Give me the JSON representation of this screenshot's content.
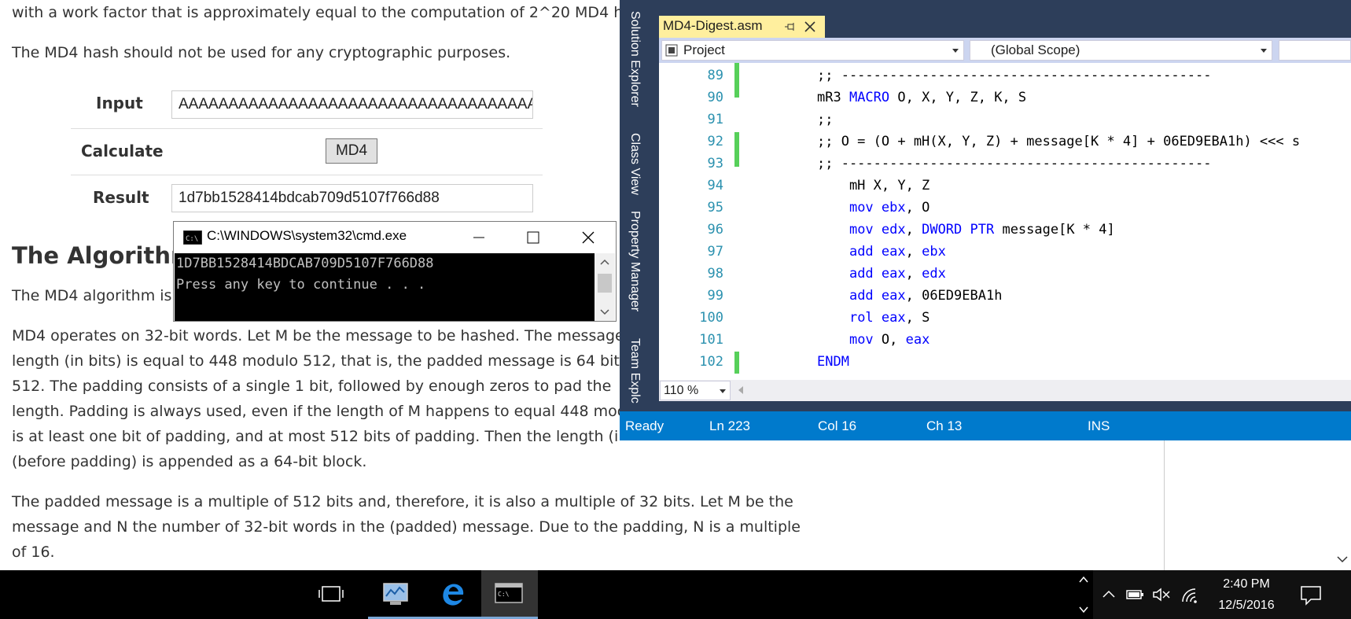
{
  "web": {
    "intro_line": "with a work factor that is approximately equal to the computation of 2^20 MD4 h",
    "warning": "The MD4 hash should not be used for any cryptographic purposes.",
    "form": {
      "input_label": "Input",
      "input_value": "AAAAAAAAAAAAAAAAAAAAAAAAAAAAAAAAAAAAAA",
      "calculate_label": "Calculate",
      "button_label": "MD4",
      "result_label": "Result",
      "result_value": "1d7bb1528414bdcab709d5107f766d88"
    },
    "heading": "The Algorithm",
    "algo_line": "The MD4 algorithm is",
    "paragraph1": [
      "MD4 operates on 32-bit words. Let M be the message to be hashed. The message",
      "length (in bits) is equal to 448 modulo 512, that is, the padded message is 64 bit",
      "512. The padding consists of a single 1 bit, followed by enough zeros to pad the",
      "length. Padding is always used, even if the length of M happens to equal 448 moc",
      "is at least one bit of padding, and at most 512 bits of padding. Then the length (i",
      "(before padding) is appended as a 64-bit block."
    ],
    "paragraph2": [
      "The padded message is a multiple of 512 bits and, therefore, it is also a multiple of 32 bits. Let M be the",
      "message and N the number of 32-bit words in the (padded) message. Due to the padding, N is a multiple",
      "of 16."
    ]
  },
  "cmd": {
    "title": "C:\\WINDOWS\\system32\\cmd.exe",
    "icon_label": "C:\\",
    "lines": [
      "1D7BB1528414BDCAB709D5107F766D88",
      "Press any key to continue . . ."
    ]
  },
  "vs": {
    "side_tabs": [
      "Solution Explorer",
      "Class View",
      "Property Manager",
      "Team Explc"
    ],
    "doc_tab": "MD4-Digest.asm",
    "project_combo": "Project",
    "scope_combo": "(Global Scope)",
    "zoom": "110 %",
    "code": [
      {
        "ln": "89",
        "text": ";; ----------------------------------------------"
      },
      {
        "ln": "90",
        "text": "mR3 MACRO O, X, Y, Z, K, S"
      },
      {
        "ln": "91",
        "text": ";;"
      },
      {
        "ln": "92",
        "text": ";; O = (O + mH(X, Y, Z) + message[K * 4] + 06ED9EBA1h) <<< s"
      },
      {
        "ln": "93",
        "text": ";; ----------------------------------------------"
      },
      {
        "ln": "94",
        "text": "    mH X, Y, Z"
      },
      {
        "ln": "95",
        "text": "    mov ebx, O"
      },
      {
        "ln": "96",
        "text": "    mov edx, DWORD PTR message[K * 4]"
      },
      {
        "ln": "97",
        "text": "    add eax, ebx"
      },
      {
        "ln": "98",
        "text": "    add eax, edx"
      },
      {
        "ln": "99",
        "text": "    add eax, 06ED9EBA1h"
      },
      {
        "ln": "100",
        "text": "    rol eax, S"
      },
      {
        "ln": "101",
        "text": "    mov O, eax"
      },
      {
        "ln": "102",
        "text": "ENDM"
      }
    ],
    "status": {
      "ready": "Ready",
      "ln": "Ln 223",
      "col": "Col 16",
      "ch": "Ch 13",
      "mode": "INS"
    }
  },
  "taskbar": {
    "time": "2:40 PM",
    "date": "12/5/2016"
  }
}
